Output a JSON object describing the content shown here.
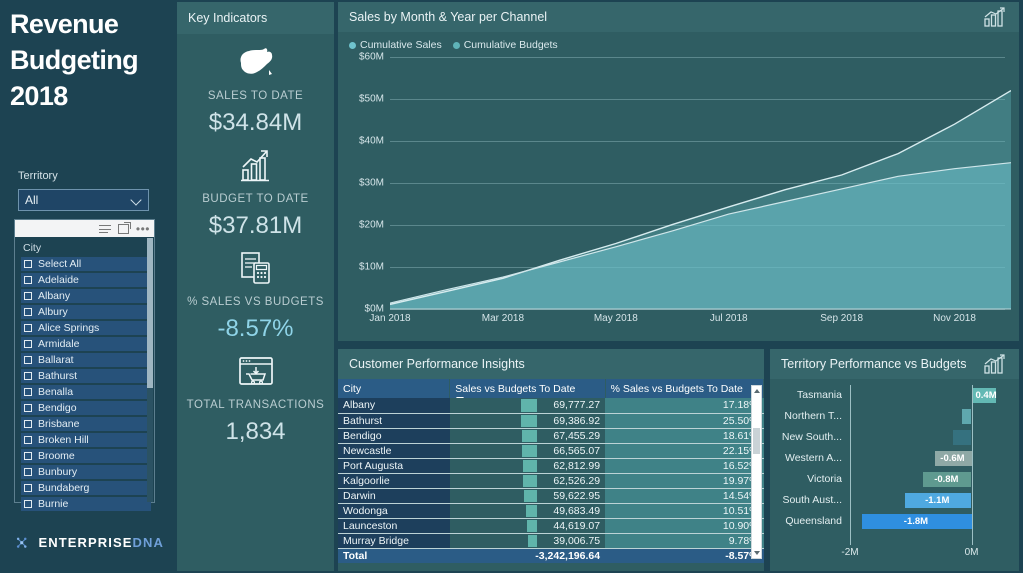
{
  "report": {
    "title_lines": [
      "Revenue",
      "Budgeting",
      "2018"
    ],
    "brand_primary": "ENTERPRISE",
    "brand_secondary": "DNA"
  },
  "filters": {
    "territory_label": "Territory",
    "territory_value": "All",
    "city_header": "City",
    "cities": [
      "Select All",
      "Adelaide",
      "Albany",
      "Albury",
      "Alice Springs",
      "Armidale",
      "Ballarat",
      "Bathurst",
      "Benalla",
      "Bendigo",
      "Brisbane",
      "Broken Hill",
      "Broome",
      "Bunbury",
      "Bundaberg",
      "Burnie"
    ]
  },
  "kpi_panel": {
    "title": "Key Indicators",
    "items": [
      {
        "icon": "australia-map-icon",
        "label": "SALES TO DATE",
        "value": "$34.84M",
        "accent": false
      },
      {
        "icon": "growth-chart-icon",
        "label": "BUDGET TO DATE",
        "value": "$37.81M",
        "accent": false
      },
      {
        "icon": "invoice-calculator-icon",
        "label": "% SALES VS BUDGETS",
        "value": "-8.57%",
        "accent": true
      },
      {
        "icon": "shopping-cart-window-icon",
        "label": "TOTAL TRANSACTIONS",
        "value": "1,834",
        "accent": false
      }
    ]
  },
  "area_chart": {
    "title": "Sales by Month & Year per Channel",
    "header_icon": "bar-chart-trend-icon"
  },
  "chart_data": {
    "type": "area",
    "title": "Sales by Month & Year per Channel",
    "xlabel": "",
    "ylabel": "",
    "ylim": [
      0,
      60
    ],
    "yticks": [
      "$0M",
      "$10M",
      "$20M",
      "$30M",
      "$40M",
      "$50M",
      "$60M"
    ],
    "ytick_values": [
      0,
      10,
      20,
      30,
      40,
      50,
      60
    ],
    "x": [
      "Jan 2018",
      "Feb 2018",
      "Mar 2018",
      "Apr 2018",
      "May 2018",
      "Jun 2018",
      "Jul 2018",
      "Aug 2018",
      "Sep 2018",
      "Oct 2018",
      "Nov 2018",
      "Dec 2018"
    ],
    "xticks": [
      "Jan 2018",
      "Mar 2018",
      "May 2018",
      "Jul 2018",
      "Sep 2018",
      "Nov 2018"
    ],
    "grid": true,
    "legend_position": "top-left",
    "series": [
      {
        "name": "Cumulative Sales",
        "color": "#6fc3cd",
        "values": [
          1.4,
          4.6,
          7.6,
          11.2,
          14.8,
          18.6,
          22.6,
          25.6,
          28.6,
          31.6,
          33.4,
          34.84
        ]
      },
      {
        "name": "Cumulative Budgets",
        "color": "#5fb3b8",
        "values": [
          1.1,
          4.2,
          7.3,
          11.6,
          15.6,
          20.1,
          24.3,
          28.4,
          31.9,
          37.0,
          44.0,
          52.0
        ]
      }
    ]
  },
  "table_card": {
    "title": "Customer Performance Insights",
    "columns": [
      "City",
      "Sales vs Budgets To Date",
      "% Sales vs Budgets To Date"
    ],
    "sorted_column": "Sales vs Budgets To Date",
    "rows": [
      {
        "city": "Albany",
        "sales_vs_budgets": "69,777.27",
        "pct": "17.18%",
        "bar": 1.0
      },
      {
        "city": "Bathurst",
        "sales_vs_budgets": "69,386.92",
        "pct": "25.50%",
        "bar": 0.99
      },
      {
        "city": "Bendigo",
        "sales_vs_budgets": "67,455.29",
        "pct": "18.61%",
        "bar": 0.97
      },
      {
        "city": "Newcastle",
        "sales_vs_budgets": "66,565.07",
        "pct": "22.15%",
        "bar": 0.95
      },
      {
        "city": "Port Augusta",
        "sales_vs_budgets": "62,812.99",
        "pct": "16.52%",
        "bar": 0.9
      },
      {
        "city": "Kalgoorlie",
        "sales_vs_budgets": "62,526.29",
        "pct": "19.97%",
        "bar": 0.9
      },
      {
        "city": "Darwin",
        "sales_vs_budgets": "59,622.95",
        "pct": "14.54%",
        "bar": 0.85
      },
      {
        "city": "Wodonga",
        "sales_vs_budgets": "49,683.49",
        "pct": "10.51%",
        "bar": 0.71
      },
      {
        "city": "Launceston",
        "sales_vs_budgets": "44,619.07",
        "pct": "10.90%",
        "bar": 0.64
      },
      {
        "city": "Murray Bridge",
        "sales_vs_budgets": "39,006.75",
        "pct": "9.78%",
        "bar": 0.56
      }
    ],
    "total": {
      "city": "Total",
      "sales_vs_budgets": "-3,242,196.64",
      "pct": "-8.57%"
    }
  },
  "territory_chart": {
    "title": "Territory Performance vs Budgets",
    "header_icon": "bar-chart-trend-icon"
  },
  "territory_chart_data": {
    "type": "bar",
    "orientation": "horizontal",
    "title": "Territory Performance vs Budgets",
    "categories": [
      "Tasmania",
      "Northern T...",
      "New South...",
      "Western A...",
      "Victoria",
      "South Aust...",
      "Queensland"
    ],
    "values": [
      0.4,
      -0.15,
      -0.3,
      -0.6,
      -0.8,
      -1.1,
      -1.8
    ],
    "labels": [
      "0.4M",
      "",
      "",
      "-0.6M",
      "-0.8M",
      "-1.1M",
      "-1.8M"
    ],
    "colors": [
      "#63b9b4",
      "#5fa8ae",
      "#35717f",
      "#8fa9a6",
      "#5f9a90",
      "#4fa9e0",
      "#2f8fe0"
    ],
    "xlim": [
      -2,
      0.6
    ],
    "xticks": [
      "-2M",
      "0M"
    ],
    "xtick_values": [
      -2,
      0
    ]
  },
  "colors": {
    "page_bg": "#1d4352",
    "card_bg": "#2f5d62",
    "card_head_bg": "#36666b",
    "accent_teal": "#6fc3cd",
    "accent_blue": "#2b5c86",
    "brand_blue": "#6f9fd8"
  }
}
